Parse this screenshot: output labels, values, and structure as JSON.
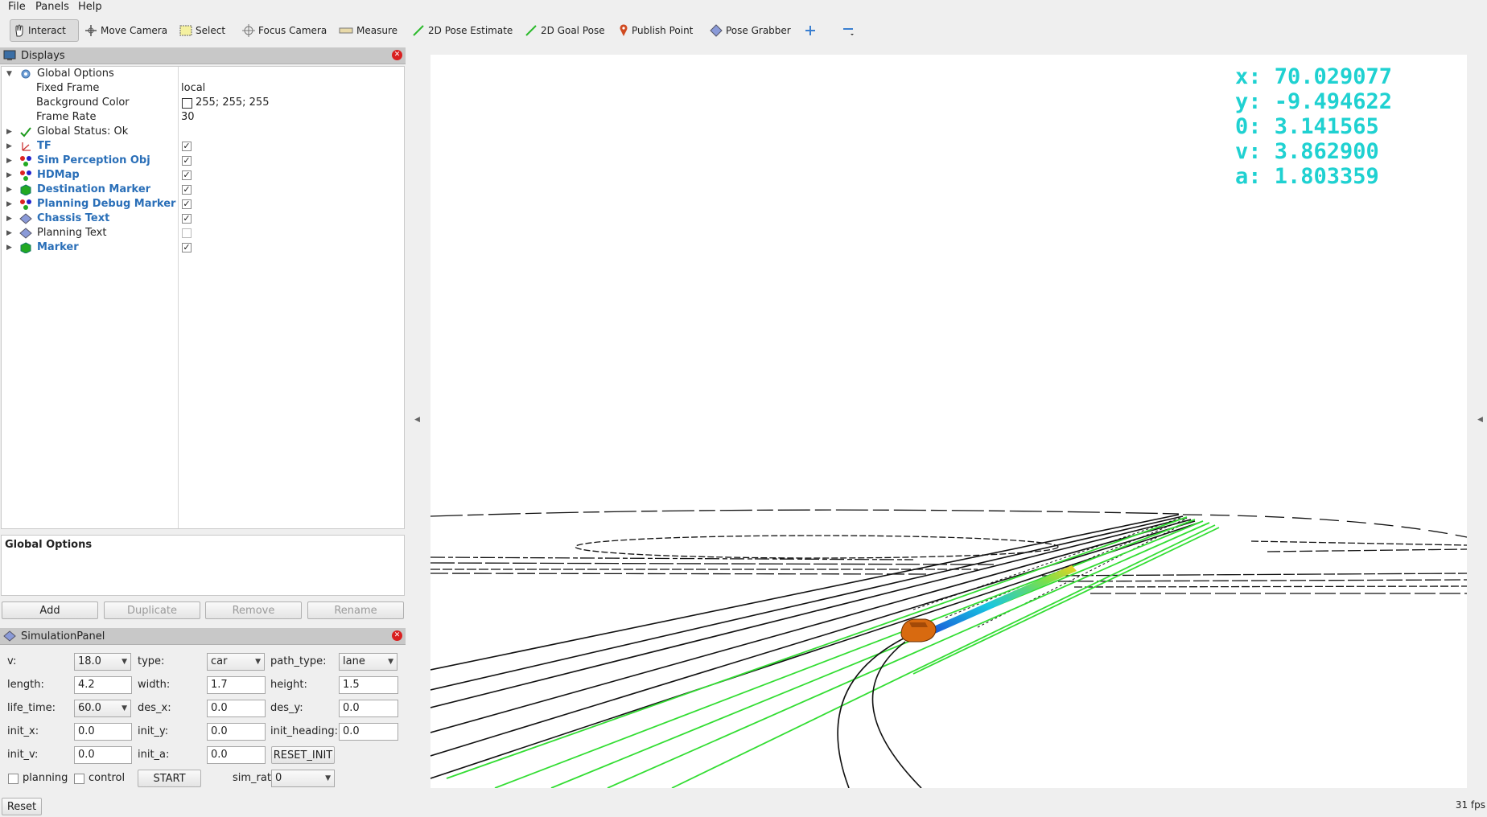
{
  "menu": {
    "file": "File",
    "panels": "Panels",
    "help": "Help"
  },
  "toolbar": {
    "interact": "Interact",
    "move_camera": "Move Camera",
    "select": "Select",
    "focus_camera": "Focus Camera",
    "measure": "Measure",
    "pose_estimate": "2D Pose Estimate",
    "goal_pose": "2D Goal Pose",
    "publish_point": "Publish Point",
    "pose_grabber": "Pose Grabber"
  },
  "displays": {
    "title": "Displays",
    "global_options": "Global Options",
    "fixed_frame": {
      "label": "Fixed Frame",
      "value": "local"
    },
    "background_color": {
      "label": "Background Color",
      "value": "255; 255; 255"
    },
    "frame_rate": {
      "label": "Frame Rate",
      "value": "30"
    },
    "global_status": "Global Status: Ok",
    "items": [
      {
        "label": "TF",
        "checked": true,
        "blue": true
      },
      {
        "label": "Sim Perception Obj",
        "checked": true,
        "blue": true
      },
      {
        "label": "HDMap",
        "checked": true,
        "blue": true
      },
      {
        "label": "Destination Marker",
        "checked": true,
        "blue": true
      },
      {
        "label": "Planning Debug Marker",
        "checked": true,
        "blue": true
      },
      {
        "label": "Chassis Text",
        "checked": true,
        "blue": true
      },
      {
        "label": "Planning Text",
        "checked": false,
        "blue": false
      },
      {
        "label": "Marker",
        "checked": true,
        "blue": true
      }
    ],
    "description_title": "Global Options",
    "buttons": {
      "add": "Add",
      "duplicate": "Duplicate",
      "remove": "Remove",
      "rename": "Rename"
    }
  },
  "sim": {
    "title": "SimulationPanel",
    "v": {
      "label": "v:",
      "value": "18.0"
    },
    "type": {
      "label": "type:",
      "value": "car"
    },
    "path_type": {
      "label": "path_type:",
      "value": "lane"
    },
    "length": {
      "label": "length:",
      "value": "4.2"
    },
    "width": {
      "label": "width:",
      "value": "1.7"
    },
    "height": {
      "label": "height:",
      "value": "1.5"
    },
    "life_time": {
      "label": "life_time:",
      "value": "60.0"
    },
    "des_x": {
      "label": "des_x:",
      "value": "0.0"
    },
    "des_y": {
      "label": "des_y:",
      "value": "0.0"
    },
    "init_x": {
      "label": "init_x:",
      "value": "0.0"
    },
    "init_y": {
      "label": "init_y:",
      "value": "0.0"
    },
    "init_heading": {
      "label": "init_heading:",
      "value": "0.0"
    },
    "init_v": {
      "label": "init_v:",
      "value": "0.0"
    },
    "init_a": {
      "label": "init_a:",
      "value": "0.0"
    },
    "reset_init": "RESET_INIT",
    "planning": "planning",
    "control": "control",
    "start": "START",
    "sim_rate": {
      "label": "sim_rate:",
      "value": "0"
    }
  },
  "bottom": {
    "reset": "Reset",
    "fps": "31 fps"
  },
  "hud": {
    "x": "x: 70.029077",
    "y": "y: -9.494622",
    "theta": "0: 3.141565",
    "v": "v: 3.862900",
    "a": "a: 1.803359"
  },
  "colors": {
    "hud": "#1fd1d1",
    "lane": "#33dd33",
    "vehicle": "#d86a10",
    "link_blue": "#2a6fb8"
  }
}
